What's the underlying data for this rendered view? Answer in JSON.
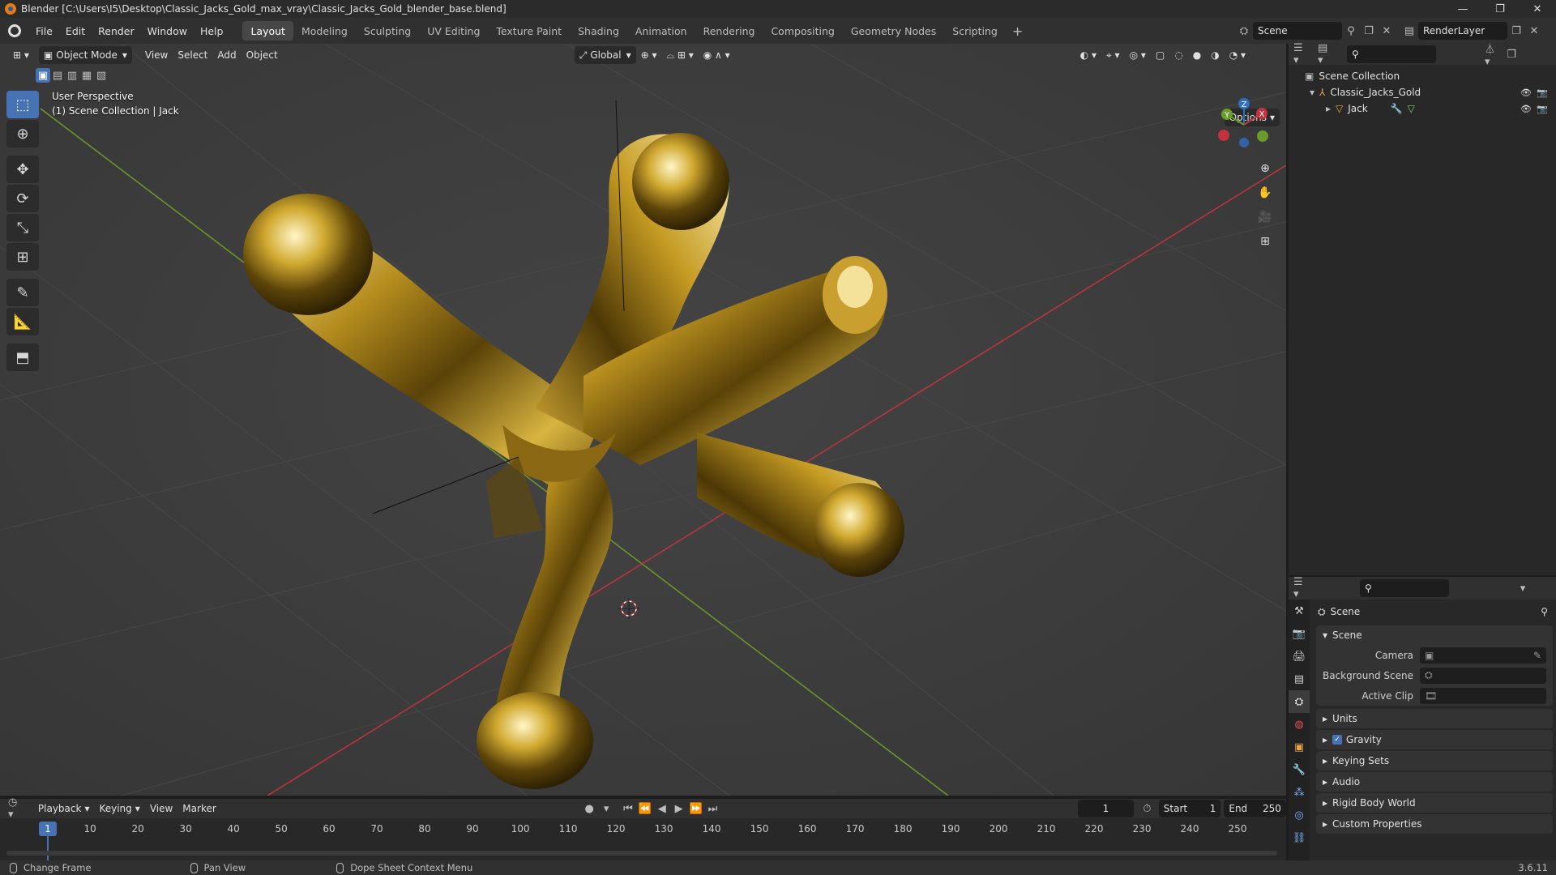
{
  "window": {
    "title": "Blender [C:\\Users\\I5\\Desktop\\Classic_Jacks_Gold_max_vray\\Classic_Jacks_Gold_blender_base.blend]",
    "minimize": "—",
    "maximize": "❐",
    "close": "✕"
  },
  "menu": {
    "file": "File",
    "edit": "Edit",
    "render": "Render",
    "window": "Window",
    "help": "Help"
  },
  "workspaces": [
    "Layout",
    "Modeling",
    "Sculpting",
    "UV Editing",
    "Texture Paint",
    "Shading",
    "Animation",
    "Rendering",
    "Compositing",
    "Geometry Nodes",
    "Scripting"
  ],
  "active_workspace": "Layout",
  "scene_name": "Scene",
  "view_layer": "RenderLayer",
  "viewport": {
    "mode": "Object Mode",
    "menus": {
      "view": "View",
      "select": "Select",
      "add": "Add",
      "object": "Object"
    },
    "orientation": "Global",
    "options": "Options",
    "info_line1": "User Perspective",
    "info_line2": "(1) Scene Collection | Jack",
    "gizmo": {
      "z": "Z",
      "y": "Y",
      "x": "X"
    }
  },
  "outliner": {
    "rows": [
      {
        "label": "Scene Collection",
        "indent": 0
      },
      {
        "label": "Classic_Jacks_Gold",
        "indent": 1
      },
      {
        "label": "Jack",
        "indent": 2
      }
    ]
  },
  "properties": {
    "context_title": "Scene",
    "panel_scene": "Scene",
    "camera_label": "Camera",
    "background_label": "Background Scene",
    "clip_label": "Active Clip",
    "units": "Units",
    "gravity": "Gravity",
    "keying_sets": "Keying Sets",
    "audio": "Audio",
    "rigid_body_world": "Rigid Body World",
    "custom_properties": "Custom Properties"
  },
  "timeline": {
    "playback": "Playback",
    "keying": "Keying",
    "view": "View",
    "marker": "Marker",
    "current_frame": "1",
    "start_label": "Start",
    "start": "1",
    "end_label": "End",
    "end": "250",
    "ticks": [
      "1",
      "10",
      "20",
      "30",
      "40",
      "50",
      "60",
      "70",
      "80",
      "90",
      "100",
      "110",
      "120",
      "130",
      "140",
      "150",
      "160",
      "170",
      "180",
      "190",
      "200",
      "210",
      "220",
      "230",
      "240",
      "250"
    ]
  },
  "status": {
    "left": "Change Frame",
    "middle": "Pan View",
    "right": "Dope Sheet Context Menu",
    "version": "3.6.11"
  },
  "colors": {
    "accent": "#4772b3",
    "gold": "#c9a227",
    "axis_x": "#c0343e",
    "axis_y": "#6b9b2a",
    "axis_z": "#2f6fc0"
  }
}
